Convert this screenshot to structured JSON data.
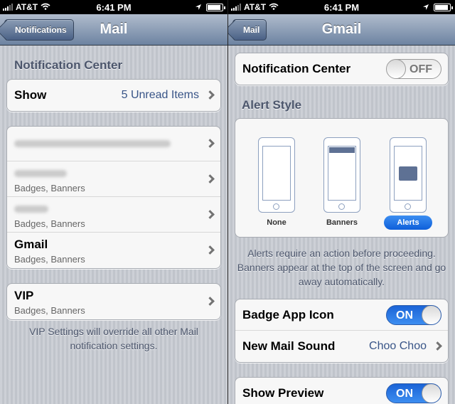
{
  "status_bar": {
    "carrier": "AT&T",
    "time": "6:41 PM"
  },
  "left": {
    "nav": {
      "back_label": "Notifications",
      "title": "Mail"
    },
    "section_header": "Notification Center",
    "show_row": {
      "label": "Show",
      "value": "5 Unread Items"
    },
    "accounts": [
      {
        "label": "",
        "sub": ""
      },
      {
        "label": "",
        "sub": "Badges, Banners"
      },
      {
        "label": "",
        "sub": "Badges, Banners"
      },
      {
        "label": "Gmail",
        "sub": "Badges, Banners"
      }
    ],
    "vip": {
      "label": "VIP",
      "sub": "Badges, Banners"
    },
    "vip_note": "VIP Settings will override all other Mail notification settings."
  },
  "right": {
    "nav": {
      "back_label": "Mail",
      "title": "Gmail"
    },
    "notification_center": {
      "label": "Notification Center",
      "state": "OFF"
    },
    "alert_style": {
      "header": "Alert Style",
      "options": [
        "None",
        "Banners",
        "Alerts"
      ],
      "selected": "Alerts"
    },
    "explanation": "Alerts require an action before proceeding. Banners appear at the top of the screen and go away automatically.",
    "badge_app_icon": {
      "label": "Badge App Icon",
      "state": "ON"
    },
    "new_mail_sound": {
      "label": "New Mail Sound",
      "value": "Choo Choo"
    },
    "show_preview": {
      "label": "Show Preview",
      "state": "ON"
    }
  },
  "colors": {
    "toggle_on": "#1a63d6",
    "value_text": "#385487",
    "nav_bar": "#6d83a1"
  }
}
